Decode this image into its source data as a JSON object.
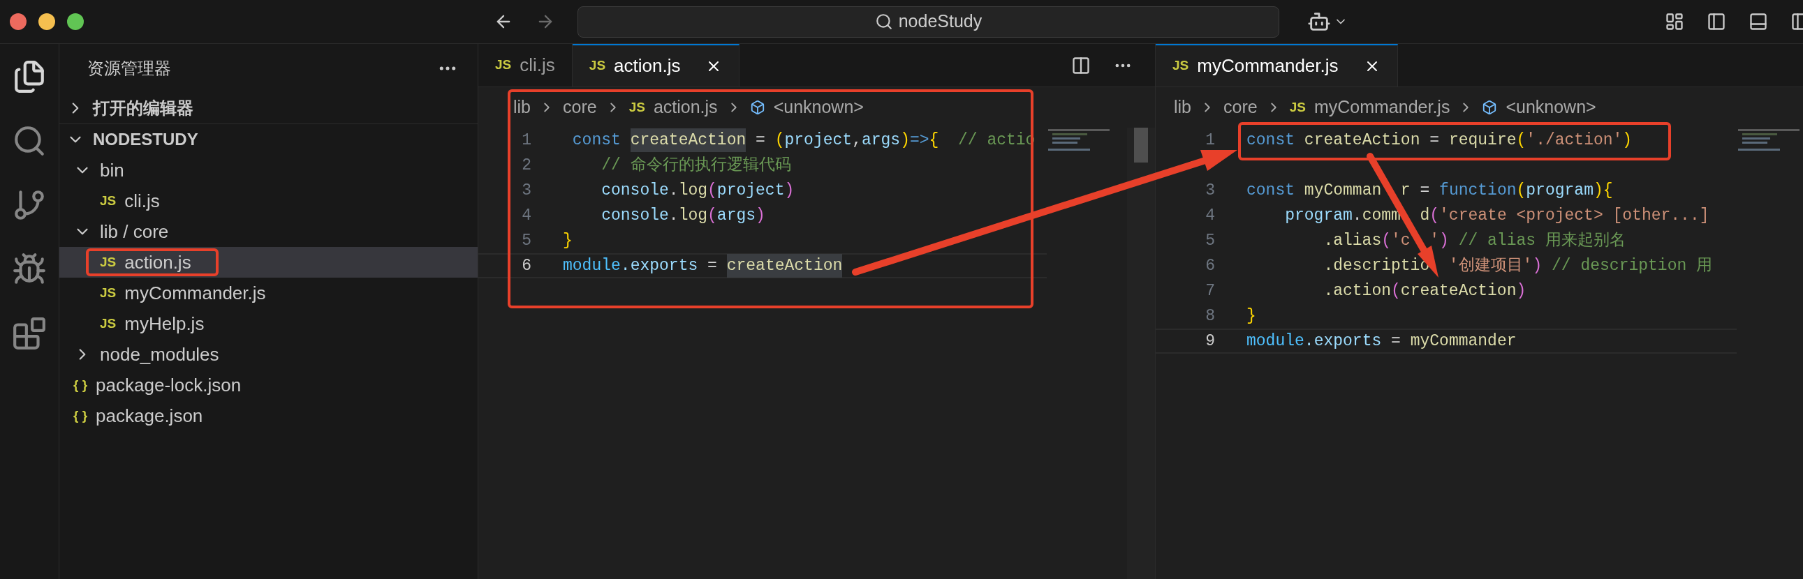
{
  "window": {
    "search": "nodeStudy"
  },
  "sidebar": {
    "title": "资源管理器",
    "sections": [
      {
        "label": "打开的编辑器",
        "expanded": false
      },
      {
        "label": "NODESTUDY",
        "expanded": true,
        "children": [
          {
            "label": "bin",
            "kind": "folder",
            "expanded": true,
            "children": [
              {
                "label": "cli.js",
                "kind": "file",
                "icon": "JS",
                "selected": false
              }
            ]
          },
          {
            "label": "lib / core",
            "kind": "folder",
            "expanded": true,
            "children": [
              {
                "label": "action.js",
                "kind": "file",
                "icon": "JS",
                "selected": true
              },
              {
                "label": "myCommander.js",
                "kind": "file",
                "icon": "JS",
                "selected": false
              },
              {
                "label": "myHelp.js",
                "kind": "file",
                "icon": "JS",
                "selected": false
              }
            ]
          },
          {
            "label": "node_modules",
            "kind": "folder",
            "expanded": false
          },
          {
            "label": "package-lock.json",
            "kind": "file",
            "icon": "{ }",
            "selected": false
          },
          {
            "label": "package.json",
            "kind": "file",
            "icon": "{ }",
            "selected": false
          }
        ]
      }
    ]
  },
  "editor_groups": [
    {
      "tabs": [
        {
          "label": "cli.js",
          "icon": "JS",
          "selected": false
        },
        {
          "label": "action.js",
          "icon": "JS",
          "selected": true
        }
      ],
      "breadcrumb": [
        {
          "label": "lib"
        },
        {
          "label": "core"
        },
        {
          "label": "action.js",
          "icon": "JS"
        }
      ],
      "symbol": "<unknown>",
      "lines": [
        {
          "number": "1",
          "current": false,
          "tokens": [
            {
              "t": " const ",
              "kind": "keyword"
            },
            {
              "t": "createAction",
              "kind": "function",
              "highlight": true
            },
            {
              "t": " = ",
              "kind": "plain"
            },
            {
              "t": "(",
              "kind": "bracket1"
            },
            {
              "t": "project",
              "kind": "variable"
            },
            {
              "t": ",",
              "kind": "plain"
            },
            {
              "t": "args",
              "kind": "variable"
            },
            {
              "t": ")",
              "kind": "bracket1"
            },
            {
              "t": "=>",
              "kind": "keyword"
            },
            {
              "t": "{",
              "kind": "bracket1"
            },
            {
              "t": "  // actio",
              "kind": "comment"
            }
          ]
        },
        {
          "number": "2",
          "current": false,
          "tokens": [
            {
              "t": "    // 命令行的执行逻辑代码",
              "kind": "comment"
            }
          ]
        },
        {
          "number": "3",
          "current": false,
          "tokens": [
            {
              "t": "    console",
              "kind": "variable"
            },
            {
              "t": ".",
              "kind": "plain"
            },
            {
              "t": "log",
              "kind": "function"
            },
            {
              "t": "(",
              "kind": "bracket2"
            },
            {
              "t": "project",
              "kind": "variable"
            },
            {
              "t": ")",
              "kind": "bracket2"
            }
          ]
        },
        {
          "number": "4",
          "current": false,
          "tokens": [
            {
              "t": "    console",
              "kind": "variable"
            },
            {
              "t": ".",
              "kind": "plain"
            },
            {
              "t": "log",
              "kind": "function"
            },
            {
              "t": "(",
              "kind": "bracket2"
            },
            {
              "t": "args",
              "kind": "variable"
            },
            {
              "t": ")",
              "kind": "bracket2"
            }
          ]
        },
        {
          "number": "5",
          "current": false,
          "tokens": [
            {
              "t": "}",
              "kind": "bracket1"
            }
          ]
        },
        {
          "number": "6",
          "current": true,
          "tokens": [
            {
              "t": "module",
              "kind": "module"
            },
            {
              "t": ".exports",
              "kind": "variable"
            },
            {
              "t": " = ",
              "kind": "plain"
            },
            {
              "t": "createAction",
              "kind": "function",
              "highlight": true
            }
          ]
        }
      ]
    },
    {
      "tabs": [
        {
          "label": "myCommander.js",
          "icon": "JS",
          "selected": true
        }
      ],
      "breadcrumb": [
        {
          "label": "lib"
        },
        {
          "label": "core"
        },
        {
          "label": "myCommander.js",
          "icon": "JS"
        }
      ],
      "symbol": "<unknown>",
      "lines": [
        {
          "number": "1",
          "current": false,
          "tokens": [
            {
              "t": "const ",
              "kind": "keyword"
            },
            {
              "t": "createAction",
              "kind": "function"
            },
            {
              "t": " = ",
              "kind": "plain"
            },
            {
              "t": "require",
              "kind": "function"
            },
            {
              "t": "(",
              "kind": "bracket1"
            },
            {
              "t": "'./action'",
              "kind": "string"
            },
            {
              "t": ")",
              "kind": "bracket1"
            }
          ]
        },
        {
          "number": "3",
          "current": false,
          "blank_line_before": true,
          "tokens": [
            {
              "t": "const ",
              "kind": "keyword"
            },
            {
              "t": "myComman",
              "kind": "function"
            },
            {
              "t": "r",
              "kind": "function",
              "gap_before": true
            },
            {
              "t": " = ",
              "kind": "plain"
            },
            {
              "t": "function",
              "kind": "keyword"
            },
            {
              "t": "(",
              "kind": "bracket1"
            },
            {
              "t": "program",
              "kind": "variable"
            },
            {
              "t": ")",
              "kind": "bracket1"
            },
            {
              "t": "{",
              "kind": "bracket1"
            }
          ]
        },
        {
          "number": "4",
          "current": false,
          "tokens": [
            {
              "t": "    program",
              "kind": "variable"
            },
            {
              "t": ".",
              "kind": "plain"
            },
            {
              "t": "comm",
              "kind": "function"
            },
            {
              "t": "d",
              "kind": "function",
              "gap_before": true
            },
            {
              "t": "(",
              "kind": "bracket2"
            },
            {
              "t": "'create <project> [other...]",
              "kind": "string"
            }
          ]
        },
        {
          "number": "5",
          "current": false,
          "tokens": [
            {
              "t": "        .alias",
              "kind": "function"
            },
            {
              "t": "(",
              "kind": "bracket2"
            },
            {
              "t": "'c",
              "kind": "string"
            },
            {
              "t": "'",
              "kind": "string",
              "gap_before": true
            },
            {
              "t": ")",
              "kind": "bracket2"
            },
            {
              "t": " // alias 用来起别名",
              "kind": "comment"
            }
          ]
        },
        {
          "number": "6",
          "current": false,
          "tokens": [
            {
              "t": "        .descriptio",
              "kind": "function"
            },
            {
              "t": "'创建项目'",
              "kind": "string",
              "gap_before": true
            },
            {
              "t": ")",
              "kind": "bracket2"
            },
            {
              "t": " // description 用",
              "kind": "comment"
            }
          ]
        },
        {
          "number": "7",
          "current": false,
          "tokens": [
            {
              "t": "        .action",
              "kind": "function"
            },
            {
              "t": "(",
              "kind": "bracket2"
            },
            {
              "t": "createAction",
              "kind": "function"
            },
            {
              "t": ")",
              "kind": "bracket2"
            }
          ]
        },
        {
          "number": "8",
          "current": false,
          "tokens": [
            {
              "t": "}",
              "kind": "bracket1"
            }
          ]
        },
        {
          "number": "9",
          "current": true,
          "tokens": [
            {
              "t": "module",
              "kind": "module"
            },
            {
              "t": ".exports",
              "kind": "variable"
            },
            {
              "t": " = ",
              "kind": "plain"
            },
            {
              "t": "myCommander",
              "kind": "function"
            }
          ]
        }
      ]
    }
  ]
}
